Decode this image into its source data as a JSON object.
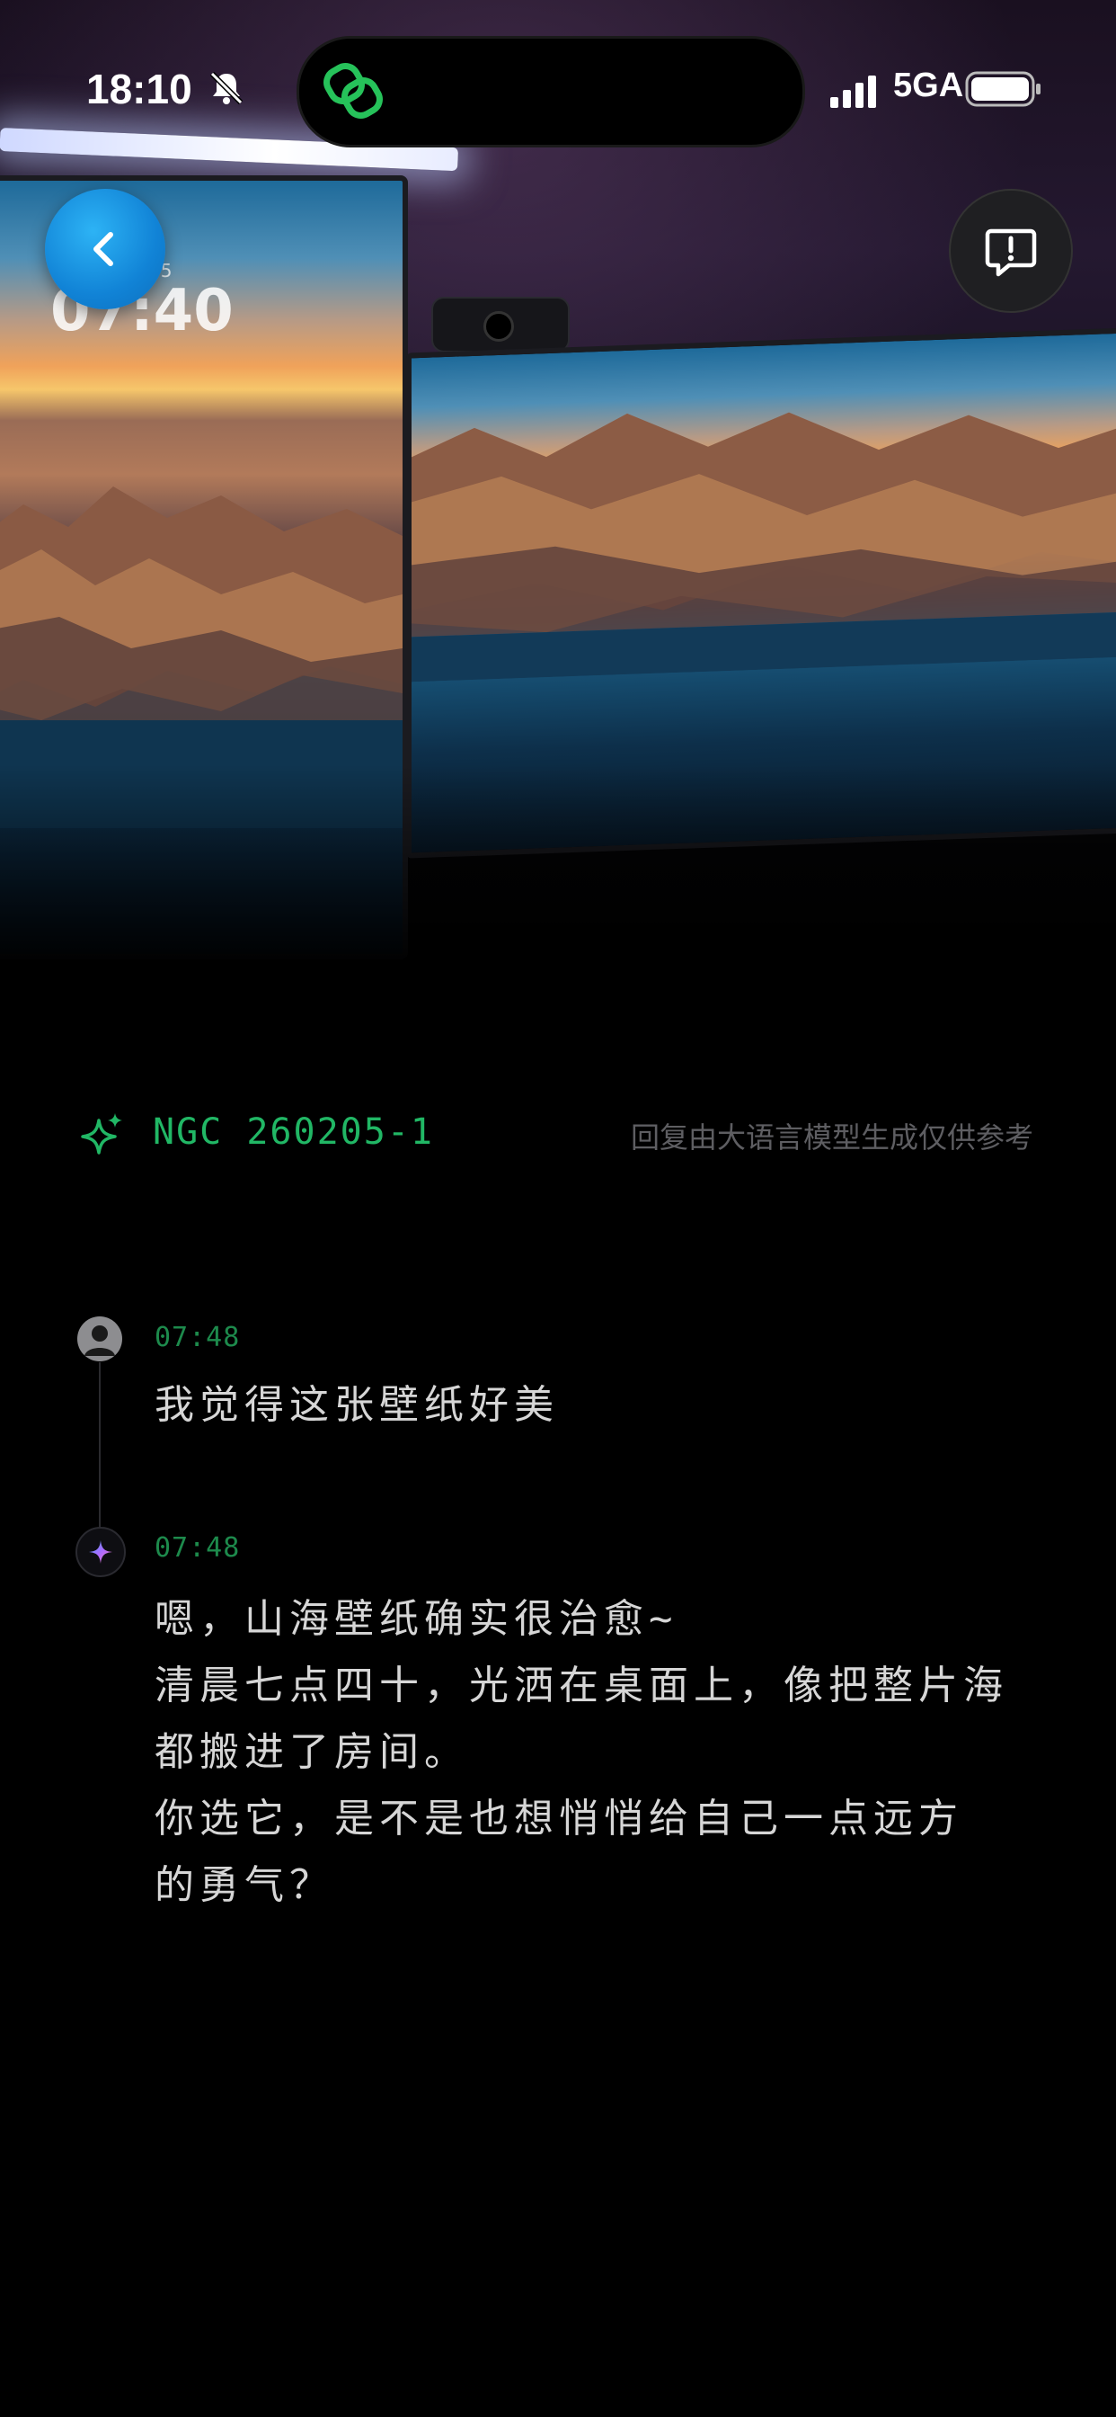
{
  "status_bar": {
    "time": "18:10",
    "network": "5GA"
  },
  "wallpaper_screen": {
    "date": "b5",
    "time": "07:40"
  },
  "header": {
    "model_id": "NGC 260205-1",
    "disclaimer": "回复由大语言模型生成仅供参考"
  },
  "messages": [
    {
      "role": "user",
      "time": "07:48",
      "text": "我觉得这张壁纸好美"
    },
    {
      "role": "assistant",
      "time": "07:48",
      "text": "嗯，山海壁纸确实很治愈~\n清晨七点四十，光洒在桌面上，像把整片海\n都搬进了房间。\n你选它，是不是也想悄悄给自己一点远方\n的勇气？"
    }
  ],
  "icons": {
    "back": "chevron-left-icon",
    "feedback": "report-bubble-icon",
    "silent": "bell-slash-icon",
    "app_logo": "link-rings-icon",
    "model": "sparkle-icon"
  },
  "colors": {
    "accent_green": "#21b765",
    "back_button_blue": "#1183d6",
    "background": "#000000"
  }
}
